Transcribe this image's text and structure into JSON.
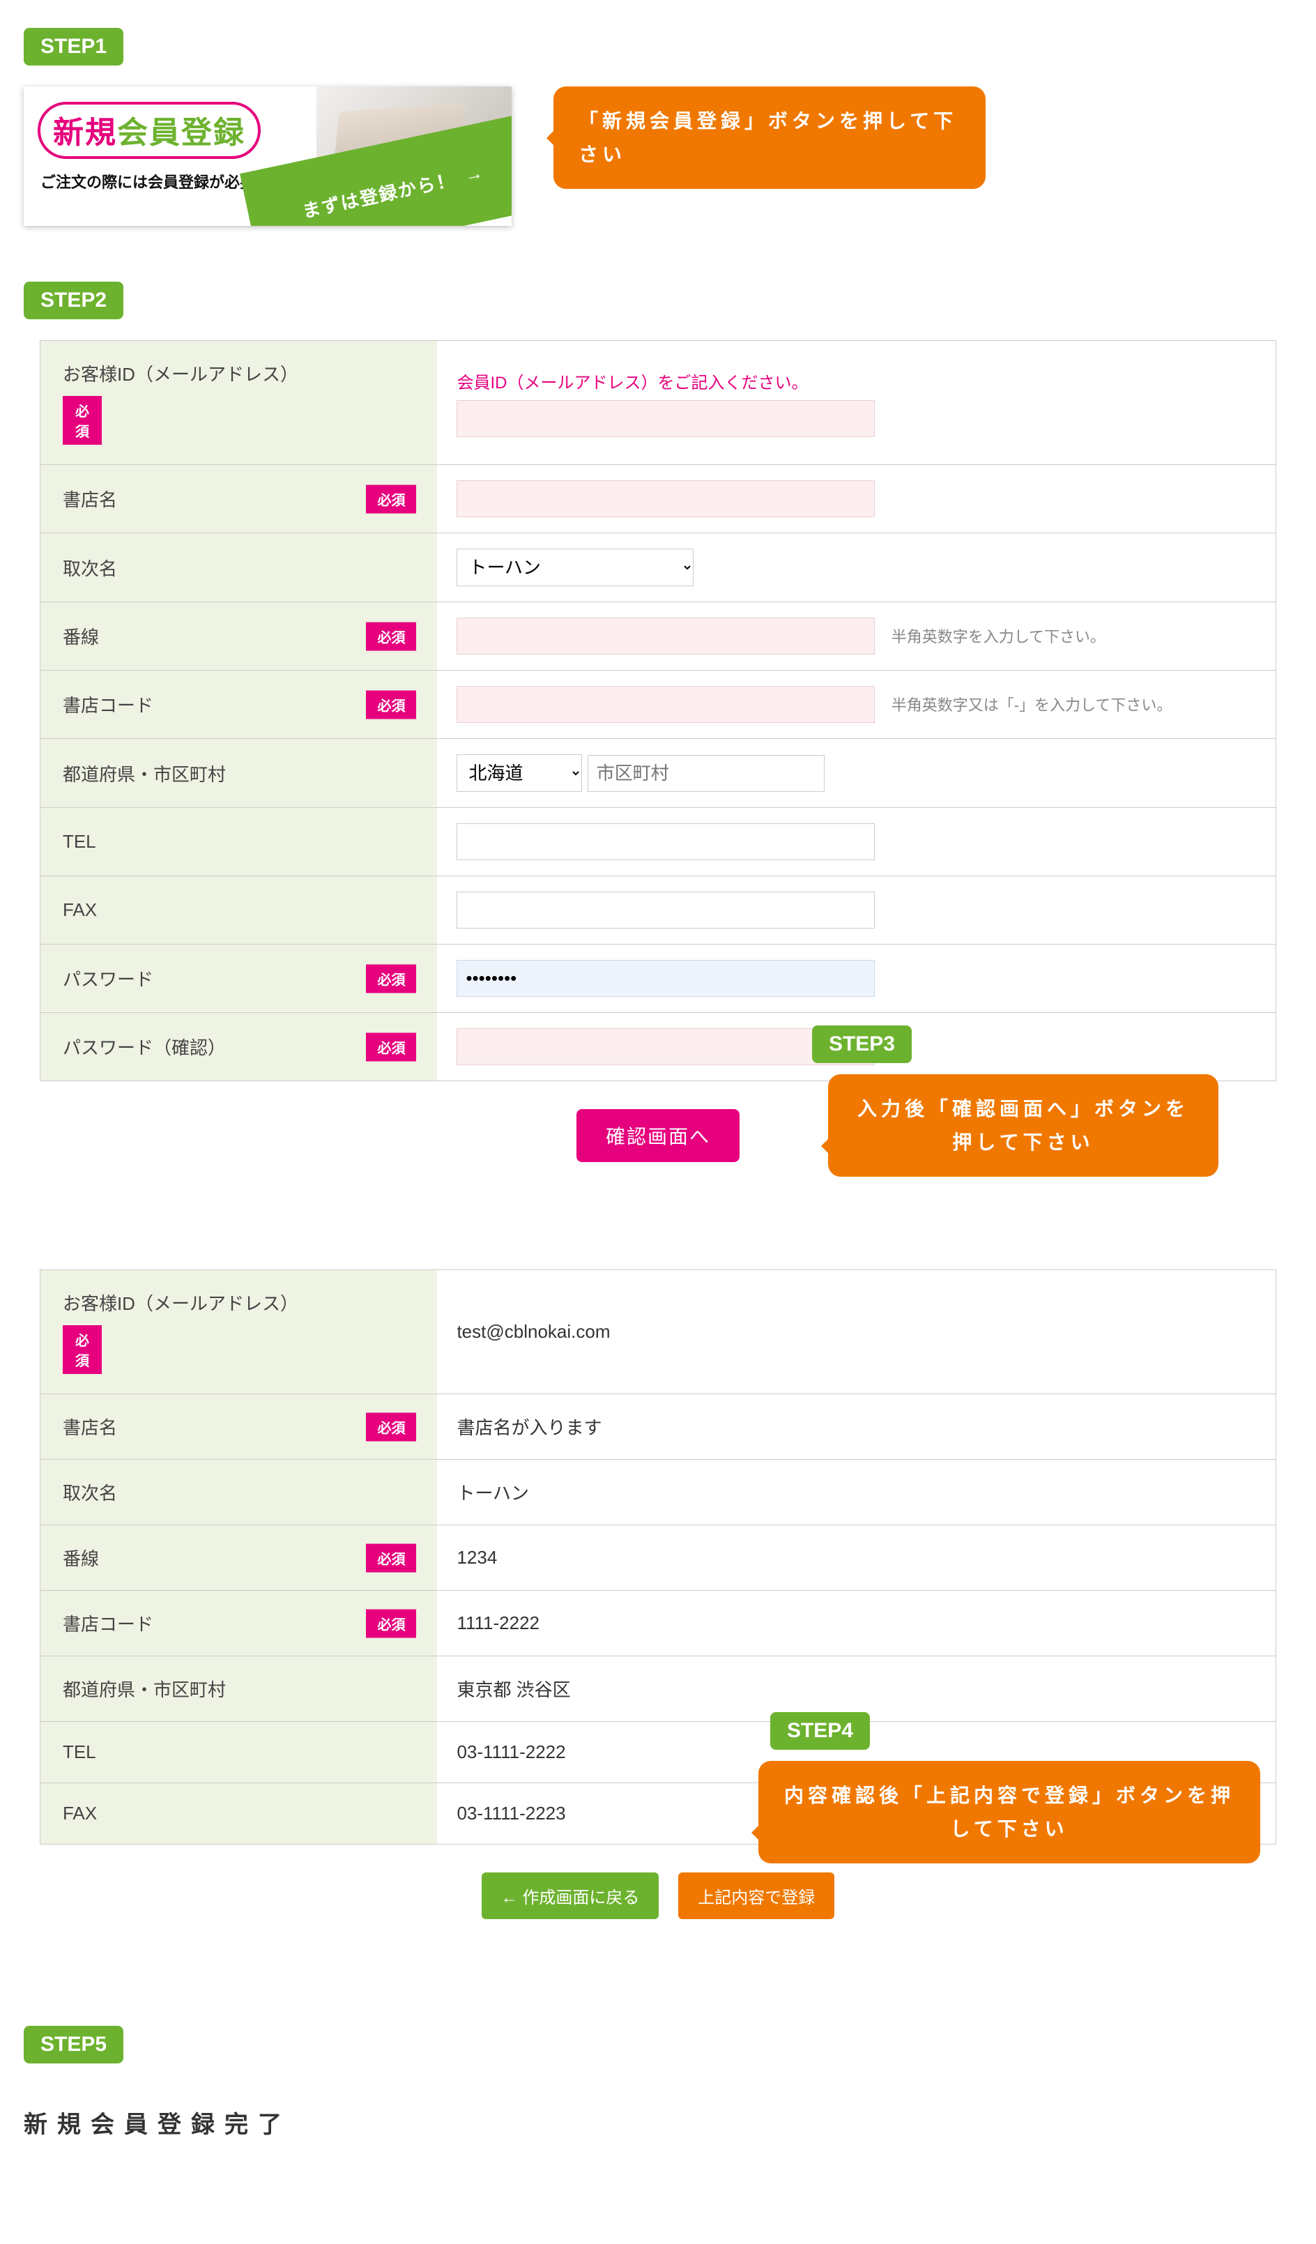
{
  "step1": {
    "badge": "STEP1",
    "banner_title_a": "新規",
    "banner_title_b": "会員登録",
    "banner_sub": "ご注文の際には会員登録が必要です。",
    "banner_ribbon": "まずは登録から！",
    "bubble": "「新規会員登録」ボタンを押して下さい"
  },
  "step2": {
    "badge": "STEP2",
    "required_label": "必須",
    "fields": {
      "id_label": "お客様ID（メールアドレス）",
      "id_note": "会員ID（メールアドレス）をご記入ください。",
      "store_label": "書店名",
      "agent_label": "取次名",
      "agent_option": "トーハン",
      "line_label": "番線",
      "line_hint": "半角英数字を入力して下さい。",
      "code_label": "書店コード",
      "code_hint": "半角英数字又は「-」を入力して下さい。",
      "pref_label": "都道府県・市区町村",
      "pref_option": "北海道",
      "city_placeholder": "市区町村",
      "tel_label": "TEL",
      "fax_label": "FAX",
      "pw_label": "パスワード",
      "pw_value": "••••••••",
      "pw2_label": "パスワード（確認）"
    },
    "confirm_btn": "確認画面へ"
  },
  "step3": {
    "badge": "STEP3",
    "bubble": "入力後「確認画面へ」ボタンを押して下さい"
  },
  "confirm_table": {
    "id_label": "お客様ID（メールアドレス）",
    "id_value": "test@cblnokai.com",
    "store_label": "書店名",
    "store_value": "書店名が入ります",
    "agent_label": "取次名",
    "agent_value": "トーハン",
    "line_label": "番線",
    "line_value": "1234",
    "code_label": "書店コード",
    "code_value": "1111-2222",
    "pref_label": "都道府県・市区町村",
    "pref_value": "東京都 渋谷区",
    "tel_label": "TEL",
    "tel_value": "03-1111-2222",
    "fax_label": "FAX",
    "fax_value": "03-1111-2223",
    "required_label": "必須",
    "back_btn": "← 作成画面に戻る",
    "submit_btn": "上記内容で登録"
  },
  "step4": {
    "badge": "STEP4",
    "bubble": "内容確認後「上記内容で登録」ボタンを押して下さい"
  },
  "step5": {
    "badge": "STEP5",
    "title": "新規会員登録完了"
  }
}
